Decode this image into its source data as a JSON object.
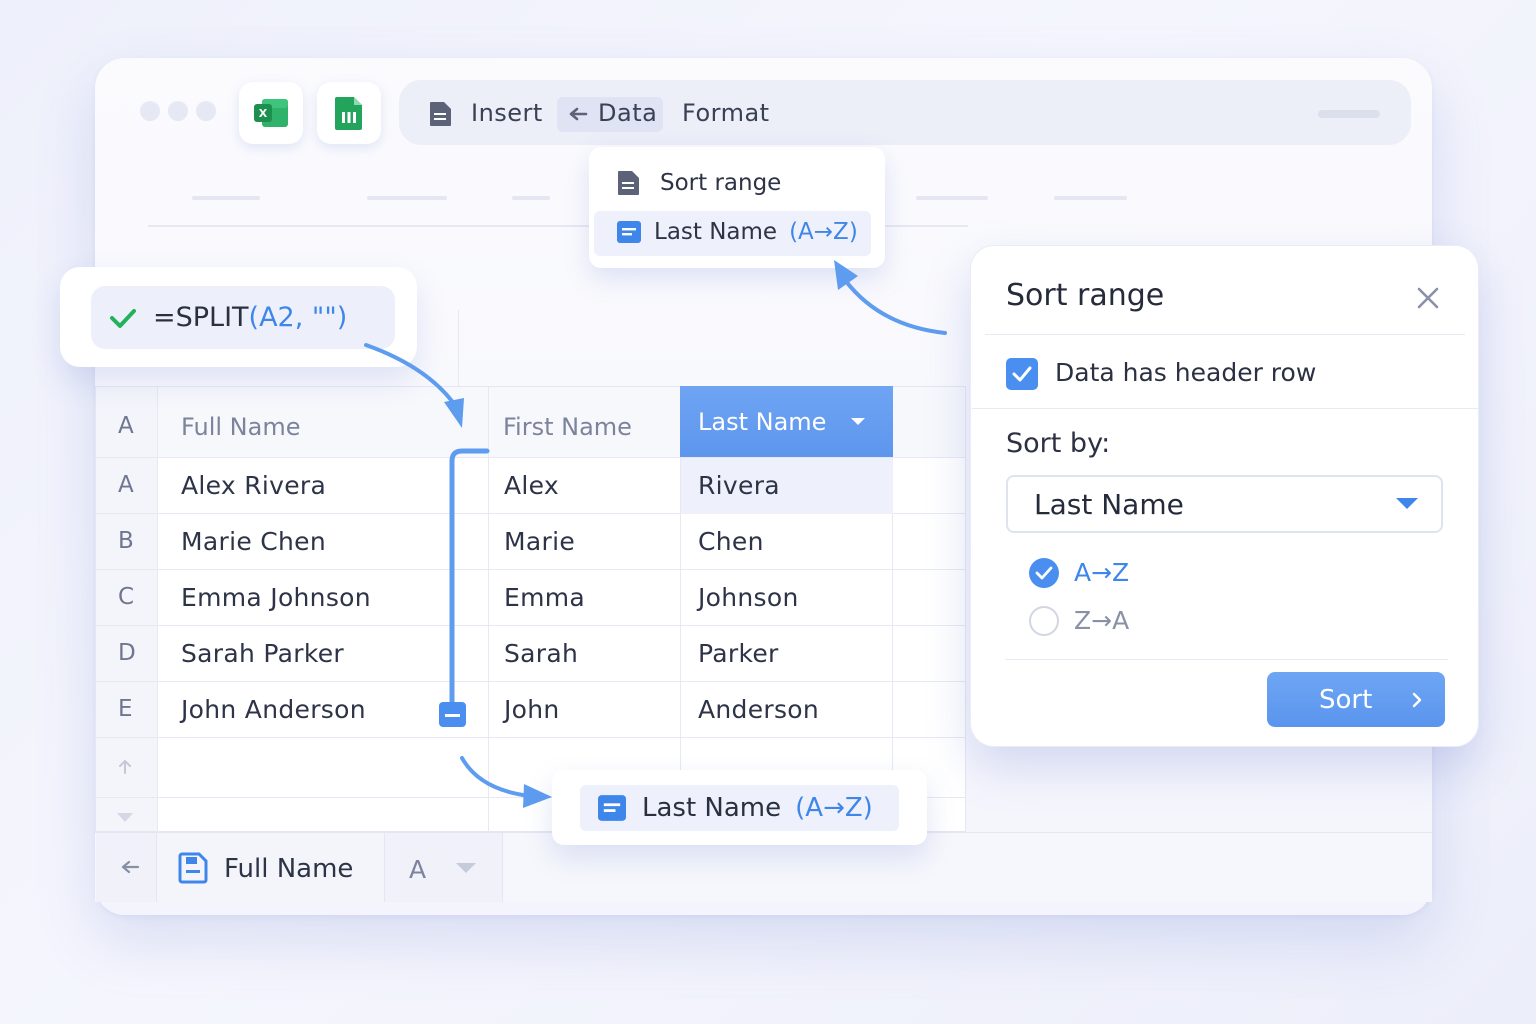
{
  "toolbar": {
    "app_icons": [
      "excel-icon",
      "sheets-icon"
    ],
    "menu": {
      "insert": "Insert",
      "data": "Data",
      "format": "Format"
    }
  },
  "data_menu": {
    "items": [
      {
        "label": "Sort range",
        "suffix": ""
      },
      {
        "label": "Last Name",
        "suffix": "(A→Z)"
      }
    ]
  },
  "formula": {
    "text_black": "=SPLIT",
    "text_blue": "(A2, \"\")",
    "status_icon": "check-icon"
  },
  "sheet": {
    "corner": "A",
    "headers": {
      "full_name": "Full Name",
      "first_name": "First Name",
      "last_name": "Last Name"
    },
    "rows": [
      {
        "head": "A",
        "full": "Alex Rivera",
        "first": "Alex",
        "last": "Rivera"
      },
      {
        "head": "B",
        "full": "Marie Chen",
        "first": "Marie",
        "last": "Chen"
      },
      {
        "head": "C",
        "full": "Emma Johnson",
        "first": "Emma",
        "last": "Johnson"
      },
      {
        "head": "D",
        "full": "Sarah Parker",
        "first": "Sarah",
        "last": "Parker"
      },
      {
        "head": "E",
        "full": "John Anderson",
        "first": "John",
        "last": "Anderson"
      }
    ],
    "selected_header_color": "#5d96ee"
  },
  "statusbar": {
    "sheet_name": "Full Name",
    "column": "A"
  },
  "tooltip_chip": {
    "label": "Last Name",
    "suffix": "(A→Z)"
  },
  "sort_dialog": {
    "title": "Sort range",
    "header_row_label": "Data has header row",
    "header_row_checked": true,
    "sort_by_label": "Sort by:",
    "sort_by_value": "Last Name",
    "options": [
      {
        "label": "A→Z",
        "selected": true
      },
      {
        "label": "Z→A",
        "selected": false
      }
    ],
    "sort_button": "Sort"
  },
  "colors": {
    "accent": "#4a8ff0",
    "excel_green": "#1d8f4e",
    "sheets_green": "#22a45d"
  }
}
